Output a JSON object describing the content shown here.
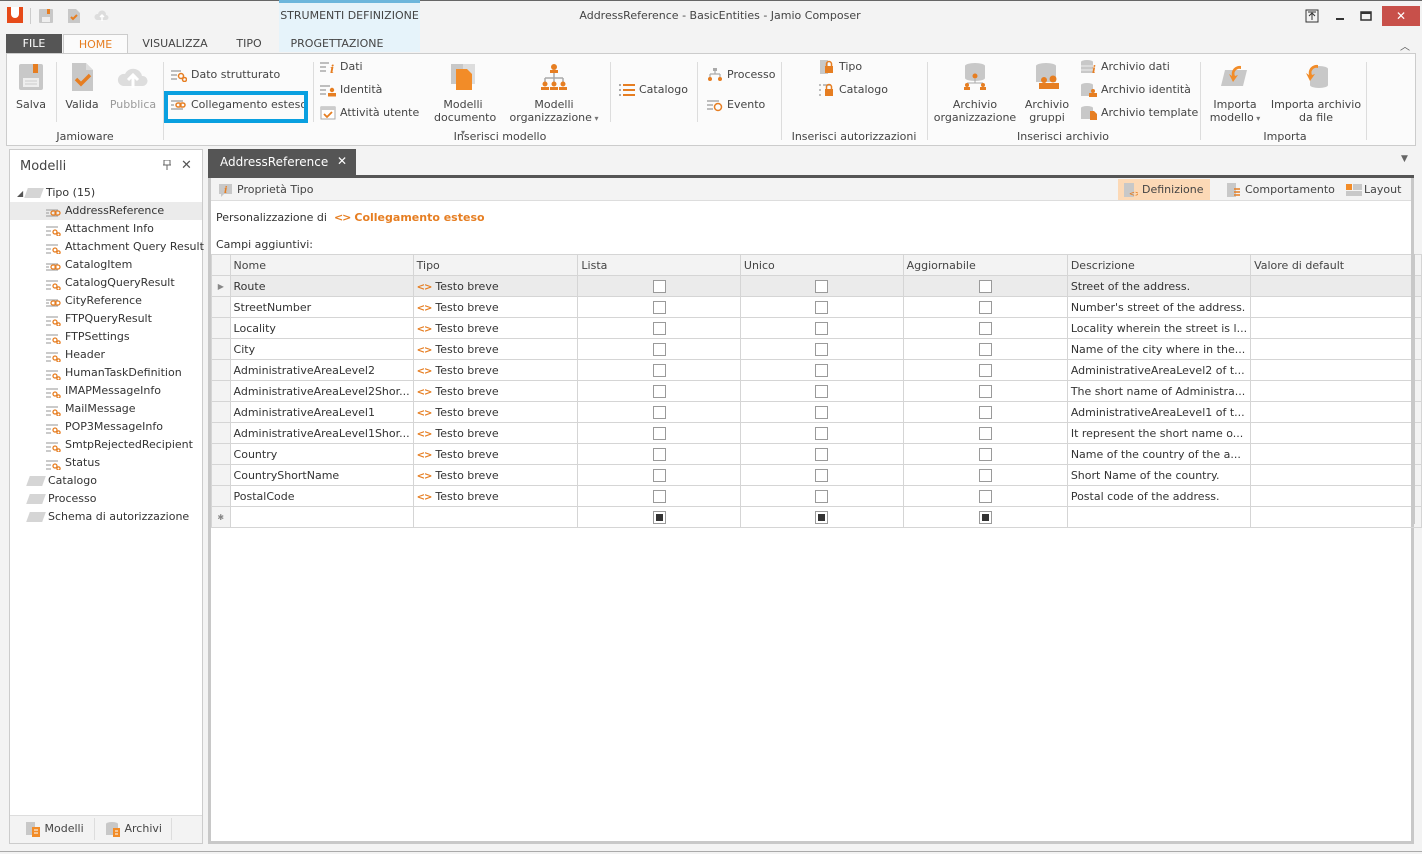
{
  "window": {
    "title": "AddressReference - BasicEntities - Jamio Composer",
    "controls": [
      "restore-down-to-tray",
      "minimize",
      "maximize",
      "close"
    ]
  },
  "quick_access": [
    "save-icon",
    "validate-icon",
    "publish-icon"
  ],
  "ribbon": {
    "contextual_group": "STRUMENTI DEFINIZIONE",
    "tabs": [
      {
        "label": "FILE"
      },
      {
        "label": "HOME",
        "active": true
      },
      {
        "label": "VISUALIZZA"
      },
      {
        "label": "TIPO"
      },
      {
        "label": "PROGETTAZIONE"
      }
    ],
    "groups": {
      "jamioware": {
        "label": "Jamioware",
        "salva": "Salva",
        "valida": "Valida",
        "pubblica": "Pubblica"
      },
      "inserisci_modello": {
        "label": "Inserisci modello",
        "dato_strutturato": "Dato strutturato",
        "collegamento_esteso": "Collegamento esteso",
        "dati": "Dati",
        "identita": "Identità",
        "attivita_utente": "Attività utente",
        "modelli_documento_1": "Modelli",
        "modelli_documento_2": "documento",
        "modelli_organizzazione_1": "Modelli",
        "modelli_organizzazione_2": "organizzazione",
        "catalogo": "Catalogo",
        "processo": "Processo",
        "evento": "Evento"
      },
      "inserisci_autorizzazioni": {
        "label": "Inserisci autorizzazioni",
        "tipo": "Tipo",
        "catalogo": "Catalogo"
      },
      "inserisci_archivio": {
        "label": "Inserisci archivio",
        "archivio_organizzazione_1": "Archivio",
        "archivio_organizzazione_2": "organizzazione",
        "archivio_gruppi_1": "Archivio",
        "archivio_gruppi_2": "gruppi",
        "archivio_dati": "Archivio dati",
        "archivio_identita": "Archivio identità",
        "archivio_template": "Archivio template"
      },
      "importa": {
        "label": "Importa",
        "importa_modello_1": "Importa",
        "importa_modello_2": "modello",
        "importa_archivio_1": "Importa archivio",
        "importa_archivio_2": "da file"
      }
    }
  },
  "left_pane": {
    "title": "Modelli",
    "tree": {
      "root": {
        "label": "Tipo (15)",
        "expanded": true
      },
      "children": [
        {
          "label": "AddressReference",
          "kind": "link",
          "selected": true
        },
        {
          "label": "Attachment Info",
          "kind": "struct"
        },
        {
          "label": "Attachment Query Result",
          "kind": "struct"
        },
        {
          "label": "CatalogItem",
          "kind": "link"
        },
        {
          "label": "CatalogQueryResult",
          "kind": "struct"
        },
        {
          "label": "CityReference",
          "kind": "link"
        },
        {
          "label": "FTPQueryResult",
          "kind": "struct"
        },
        {
          "label": "FTPSettings",
          "kind": "struct"
        },
        {
          "label": "Header",
          "kind": "struct"
        },
        {
          "label": "HumanTaskDefinition",
          "kind": "struct"
        },
        {
          "label": "IMAPMessageInfo",
          "kind": "struct"
        },
        {
          "label": "MailMessage",
          "kind": "struct"
        },
        {
          "label": "POP3MessageInfo",
          "kind": "struct"
        },
        {
          "label": "SmtpRejectedRecipient",
          "kind": "struct"
        },
        {
          "label": "Status",
          "kind": "struct"
        }
      ],
      "folders": [
        "Catalogo",
        "Processo",
        "Schema di autorizzazione"
      ]
    },
    "footer": {
      "modelli": "Modelli",
      "archivi": "Archivi"
    }
  },
  "document": {
    "tab_label": "AddressReference",
    "toolbar": {
      "proprieta": "Proprietà Tipo",
      "definizione": "Definizione",
      "comportamento": "Comportamento",
      "layout": "Layout"
    },
    "personalizzazione_label": "Personalizzazione di",
    "base_type": "Collegamento esteso",
    "campi_label": "Campi aggiuntivi:",
    "grid": {
      "columns": [
        "Nome",
        "Tipo",
        "Lista",
        "Unico",
        "Aggiornabile",
        "Descrizione",
        "Valore di default"
      ],
      "rows": [
        {
          "nome": "Route",
          "tipo": "Testo breve",
          "lista": false,
          "unico": false,
          "aggiornabile": false,
          "descrizione": "Street of the address.",
          "default": ""
        },
        {
          "nome": "StreetNumber",
          "tipo": "Testo breve",
          "lista": false,
          "unico": false,
          "aggiornabile": false,
          "descrizione": "Number's street of the address.",
          "default": ""
        },
        {
          "nome": "Locality",
          "tipo": "Testo breve",
          "lista": false,
          "unico": false,
          "aggiornabile": false,
          "descrizione": "Locality wherein the street is l...",
          "default": ""
        },
        {
          "nome": "City",
          "tipo": "Testo breve",
          "lista": false,
          "unico": false,
          "aggiornabile": false,
          "descrizione": "Name of the city where in the...",
          "default": ""
        },
        {
          "nome": "AdministrativeAreaLevel2",
          "tipo": "Testo breve",
          "lista": false,
          "unico": false,
          "aggiornabile": false,
          "descrizione": "AdministrativeAreaLevel2 of t...",
          "default": ""
        },
        {
          "nome": "AdministrativeAreaLevel2Shor...",
          "tipo": "Testo breve",
          "lista": false,
          "unico": false,
          "aggiornabile": false,
          "descrizione": "The short name of Administra...",
          "default": ""
        },
        {
          "nome": "AdministrativeAreaLevel1",
          "tipo": "Testo breve",
          "lista": false,
          "unico": false,
          "aggiornabile": false,
          "descrizione": "AdministrativeAreaLevel1 of t...",
          "default": ""
        },
        {
          "nome": "AdministrativeAreaLevel1Shor...",
          "tipo": "Testo breve",
          "lista": false,
          "unico": false,
          "aggiornabile": false,
          "descrizione": "It represent the short name o...",
          "default": ""
        },
        {
          "nome": "Country",
          "tipo": "Testo breve",
          "lista": false,
          "unico": false,
          "aggiornabile": false,
          "descrizione": "Name of the country of the a...",
          "default": ""
        },
        {
          "nome": "CountryShortName",
          "tipo": "Testo breve",
          "lista": false,
          "unico": false,
          "aggiornabile": false,
          "descrizione": "Short Name of the country.",
          "default": ""
        },
        {
          "nome": "PostalCode",
          "tipo": "Testo breve",
          "lista": false,
          "unico": false,
          "aggiornabile": false,
          "descrizione": "Postal code of the address.",
          "default": ""
        }
      ],
      "new_row_marker": "*",
      "new_row_checkboxes": "indeterminate"
    }
  },
  "colors": {
    "accent": "#e67e22",
    "highlight_box": "#0aa0e0",
    "contextual_group": "#e6f3fa",
    "active_toolbar": "#fcd9b6",
    "dark_tab": "#555555",
    "close_button": "#c8504a"
  }
}
